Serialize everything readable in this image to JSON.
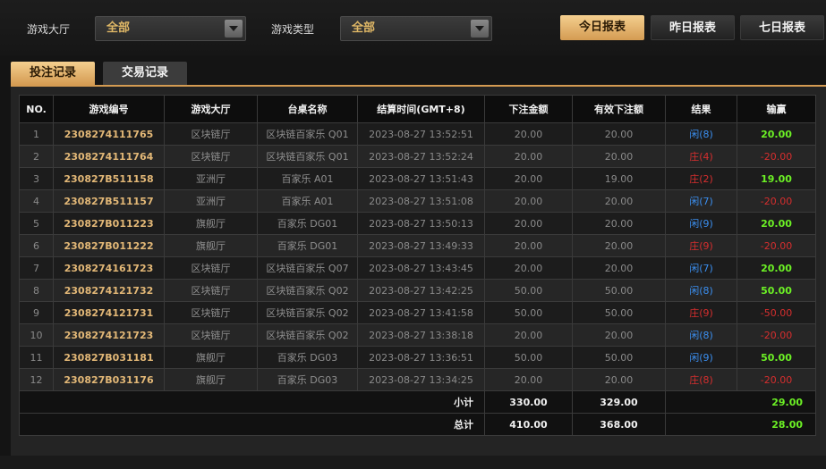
{
  "filters": {
    "hall_label": "游戏大厅",
    "hall_value": "全部",
    "type_label": "游戏类型",
    "type_value": "全部"
  },
  "report_buttons": {
    "today": "今日报表",
    "yesterday": "昨日报表",
    "seven_days": "七日报表"
  },
  "tabs": {
    "bets": "投注记录",
    "transactions": "交易记录"
  },
  "table": {
    "headers": [
      "NO.",
      "游戏编号",
      "游戏大厅",
      "台桌名称",
      "结算时间(GMT+8)",
      "下注金额",
      "有效下注额",
      "结果",
      "输赢"
    ],
    "rows": [
      {
        "no": "1",
        "id": "2308274111765",
        "hall": "区块链厅",
        "table": "区块链百家乐 Q01",
        "time": "2023-08-27 13:52:51",
        "bet": "20.00",
        "valid": "20.00",
        "result": "闲(8)",
        "result_color": "blue",
        "winloss": "20.00",
        "wl_color": "green"
      },
      {
        "no": "2",
        "id": "2308274111764",
        "hall": "区块链厅",
        "table": "区块链百家乐 Q01",
        "time": "2023-08-27 13:52:24",
        "bet": "20.00",
        "valid": "20.00",
        "result": "庄(4)",
        "result_color": "red",
        "winloss": "-20.00",
        "wl_color": "red"
      },
      {
        "no": "3",
        "id": "230827B511158",
        "hall": "亚洲厅",
        "table": "百家乐 A01",
        "time": "2023-08-27 13:51:43",
        "bet": "20.00",
        "valid": "19.00",
        "result": "庄(2)",
        "result_color": "red",
        "winloss": "19.00",
        "wl_color": "green"
      },
      {
        "no": "4",
        "id": "230827B511157",
        "hall": "亚洲厅",
        "table": "百家乐 A01",
        "time": "2023-08-27 13:51:08",
        "bet": "20.00",
        "valid": "20.00",
        "result": "闲(7)",
        "result_color": "blue",
        "winloss": "-20.00",
        "wl_color": "red"
      },
      {
        "no": "5",
        "id": "230827B011223",
        "hall": "旗舰厅",
        "table": "百家乐 DG01",
        "time": "2023-08-27 13:50:13",
        "bet": "20.00",
        "valid": "20.00",
        "result": "闲(9)",
        "result_color": "blue",
        "winloss": "20.00",
        "wl_color": "green"
      },
      {
        "no": "6",
        "id": "230827B011222",
        "hall": "旗舰厅",
        "table": "百家乐 DG01",
        "time": "2023-08-27 13:49:33",
        "bet": "20.00",
        "valid": "20.00",
        "result": "庄(9)",
        "result_color": "red",
        "winloss": "-20.00",
        "wl_color": "red"
      },
      {
        "no": "7",
        "id": "2308274161723",
        "hall": "区块链厅",
        "table": "区块链百家乐 Q07",
        "time": "2023-08-27 13:43:45",
        "bet": "20.00",
        "valid": "20.00",
        "result": "闲(7)",
        "result_color": "blue",
        "winloss": "20.00",
        "wl_color": "green"
      },
      {
        "no": "8",
        "id": "2308274121732",
        "hall": "区块链厅",
        "table": "区块链百家乐 Q02",
        "time": "2023-08-27 13:42:25",
        "bet": "50.00",
        "valid": "50.00",
        "result": "闲(8)",
        "result_color": "blue",
        "winloss": "50.00",
        "wl_color": "green"
      },
      {
        "no": "9",
        "id": "2308274121731",
        "hall": "区块链厅",
        "table": "区块链百家乐 Q02",
        "time": "2023-08-27 13:41:58",
        "bet": "50.00",
        "valid": "50.00",
        "result": "庄(9)",
        "result_color": "red",
        "winloss": "-50.00",
        "wl_color": "red"
      },
      {
        "no": "10",
        "id": "2308274121723",
        "hall": "区块链厅",
        "table": "区块链百家乐 Q02",
        "time": "2023-08-27 13:38:18",
        "bet": "20.00",
        "valid": "20.00",
        "result": "闲(8)",
        "result_color": "blue",
        "winloss": "-20.00",
        "wl_color": "red"
      },
      {
        "no": "11",
        "id": "230827B031181",
        "hall": "旗舰厅",
        "table": "百家乐 DG03",
        "time": "2023-08-27 13:36:51",
        "bet": "50.00",
        "valid": "50.00",
        "result": "闲(9)",
        "result_color": "blue",
        "winloss": "50.00",
        "wl_color": "green"
      },
      {
        "no": "12",
        "id": "230827B031176",
        "hall": "旗舰厅",
        "table": "百家乐 DG03",
        "time": "2023-08-27 13:34:25",
        "bet": "20.00",
        "valid": "20.00",
        "result": "庄(8)",
        "result_color": "red",
        "winloss": "-20.00",
        "wl_color": "red"
      }
    ],
    "subtotal": {
      "label": "小计",
      "bet": "330.00",
      "valid": "329.00",
      "winloss": "29.00"
    },
    "total": {
      "label": "总计",
      "bet": "410.00",
      "valid": "368.00",
      "winloss": "28.00"
    }
  }
}
